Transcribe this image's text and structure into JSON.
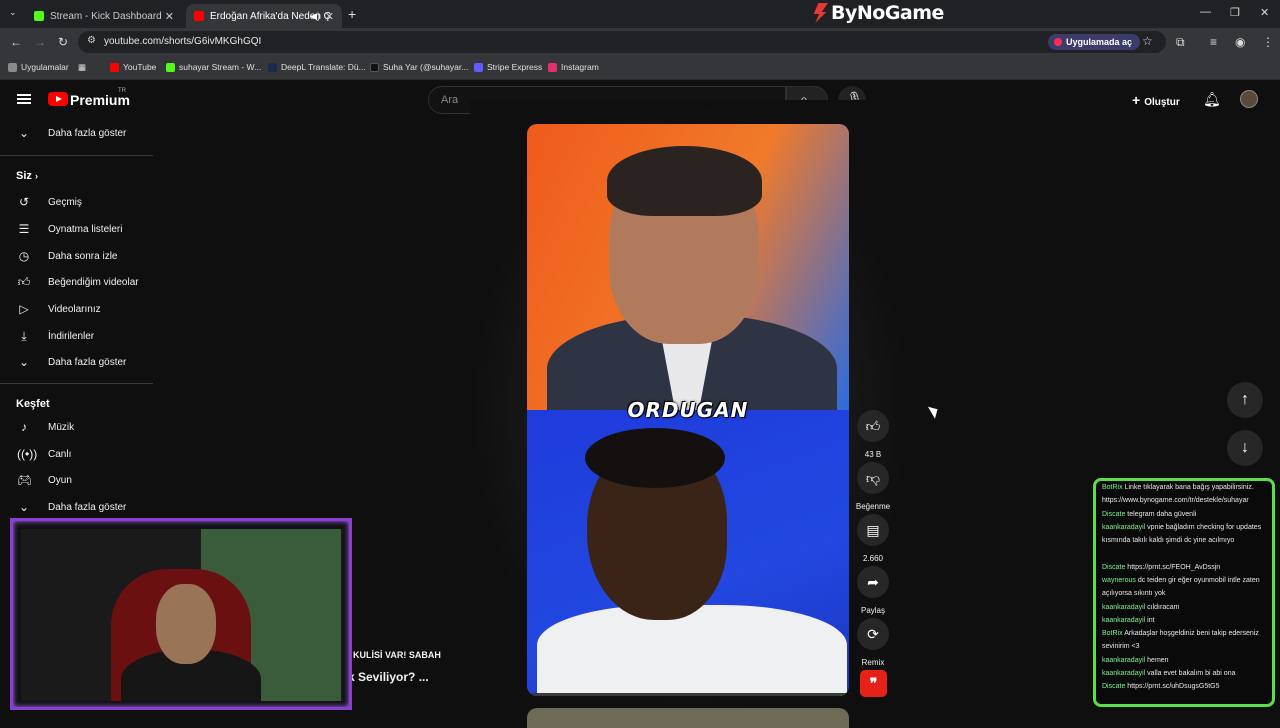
{
  "browser": {
    "tabs": [
      {
        "label": "Stream - Kick Dashboard",
        "color": "#53fc18"
      },
      {
        "label": "Erdoğan Afrika'da Neden Ç",
        "color": "#ff0000"
      }
    ],
    "brand": "ByNoGame",
    "url": "youtube.com/shorts/G6ivMKGhGQI",
    "open_in_app": "Uygulamada aç",
    "bookmarks": [
      {
        "label": "Uygulamalar",
        "color": "#8a8a8a"
      },
      {
        "label": "YouTube",
        "color": "#ff0000"
      },
      {
        "label": "suhayar Stream - W...",
        "color": "#53fc18"
      },
      {
        "label": "DeepL Translate: Dü...",
        "color": "#1b2a4a"
      },
      {
        "label": "Suha Yar (@suhayar...",
        "color": "#111111"
      },
      {
        "label": "Stripe Express",
        "color": "#635bff"
      },
      {
        "label": "Instagram",
        "color": "#e1306c"
      }
    ]
  },
  "header": {
    "logo": "Premium",
    "region": "TR",
    "search_placeholder": "Ara",
    "create": "Oluştur"
  },
  "sidebar": {
    "top_more": "Daha fazla göster",
    "you_heading": "Siz",
    "you_items": [
      "Geçmiş",
      "Oynatma listeleri",
      "Daha sonra izle",
      "Beğendiğim videolar",
      "Videolarınız",
      "İndirilenler",
      "Daha fazla göster"
    ],
    "explore_heading": "Keşfet",
    "explore_items": [
      "Müzik",
      "Canlı",
      "Oyun",
      "Daha fazla göster"
    ]
  },
  "background_video": {
    "channel_line": "N KULİSİ VAR! SABAH",
    "title_line": "k Seviliyor? ..."
  },
  "short": {
    "caption": "ORDUGAN",
    "progress": 0.0,
    "likes": "43 B",
    "dislike_label": "Beğenme",
    "comments": "2.660",
    "share_label": "Paylaş",
    "remix_label": "Remix"
  },
  "chat": {
    "messages": [
      {
        "user": "BotRix",
        "text": "Linke tıklayarak bana bağış yapabilirsiniz. https://www.bynogame.com/tr/destekle/suhayar"
      },
      {
        "user": "Discate",
        "text": "telegram daha güvenli"
      },
      {
        "user": "kaankaradayil",
        "text": "vpnie bağladım checking for updates kısmında takılı kaldı şimdi dc yine acılmıyo"
      },
      {
        "user": "Discate",
        "text": "https://prnt.sc/FEOH_AvDssjn"
      },
      {
        "user": "waynerous",
        "text": "dc teiden gir eğer oyunmobil intle zaten açılıyorsa sıkıntı yok"
      },
      {
        "user": "kaankaradayil",
        "text": "cıldıracam"
      },
      {
        "user": "kaankaradayil",
        "text": "int"
      },
      {
        "user": "BotRix",
        "text": "Arkadaşlar hoşgeldiniz beni takip ederseniz sevinirim <3"
      },
      {
        "user": "kaankaradayil",
        "text": "hemen"
      },
      {
        "user": "kaankaradayil",
        "text": "valla evet bakalım bi abi ona"
      },
      {
        "user": "Discate",
        "text": "https://prnt.sc/uhDsugsG5tG5"
      }
    ]
  }
}
